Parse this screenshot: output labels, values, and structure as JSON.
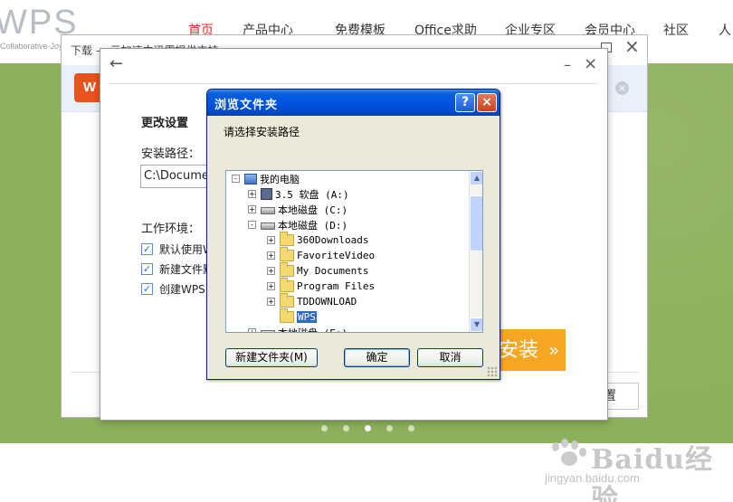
{
  "site": {
    "logo": "WPS",
    "logo_sub": "Collaborative·Joy",
    "nav": [
      "首页",
      "产品中心",
      "免费模板",
      "Office求助",
      "企业专区",
      "会员中心",
      "社区",
      "人"
    ],
    "active_nav": "首页",
    "carousel_dots": 5,
    "carousel_active": 3
  },
  "watermark": {
    "text": "Baidu经验",
    "url": "jingyan.baidu.com"
  },
  "download_window": {
    "title": "下载 — 云加速中迅雷提供支持",
    "banner_logo": "W",
    "right_button": "置"
  },
  "settings_dialog": {
    "heading": "更改设置",
    "path_label": "安装路径：",
    "path_value": "C:\\Documents and Settings",
    "env_label": "工作环境：",
    "options": [
      {
        "label": "默认使用WPS Office打开文档",
        "checked": true
      },
      {
        "label": "新建文件默认保存格式",
        "checked": true
      },
      {
        "label": "创建WPS Office桌面快捷方式",
        "checked": true
      }
    ],
    "install_button": "安装"
  },
  "browse_dialog": {
    "title": "浏览文件夹",
    "help_button": "?",
    "close_button": "×",
    "prompt": "请选择安装路径",
    "tree": [
      {
        "label": "我的电脑",
        "level": 0,
        "expander": "-",
        "icon": "computer-icon"
      },
      {
        "label": "3.5 软盘 (A:)",
        "level": 1,
        "expander": "+",
        "icon": "floppy-drive-icon"
      },
      {
        "label": "本地磁盘 (C:)",
        "level": 1,
        "expander": "+",
        "icon": "hard-drive-icon"
      },
      {
        "label": "本地磁盘 (D:)",
        "level": 1,
        "expander": "-",
        "icon": "hard-drive-icon"
      },
      {
        "label": "360Downloads",
        "level": 2,
        "expander": "+",
        "icon": "folder-icon"
      },
      {
        "label": "FavoriteVideo",
        "level": 2,
        "expander": "+",
        "icon": "folder-icon"
      },
      {
        "label": "My Documents",
        "level": 2,
        "expander": "+",
        "icon": "folder-icon"
      },
      {
        "label": "Program Files",
        "level": 2,
        "expander": "+",
        "icon": "folder-icon"
      },
      {
        "label": "TDDOWNLOAD",
        "level": 2,
        "expander": "+",
        "icon": "folder-icon"
      },
      {
        "label": "WPS",
        "level": 2,
        "expander": "",
        "icon": "folder-icon",
        "selected": true
      },
      {
        "label": "本地磁盘 (E:)",
        "level": 1,
        "expander": "+",
        "icon": "hard-drive-icon"
      }
    ],
    "buttons": {
      "new_folder": "新建文件夹(M)",
      "ok": "确定",
      "cancel": "取消"
    }
  }
}
